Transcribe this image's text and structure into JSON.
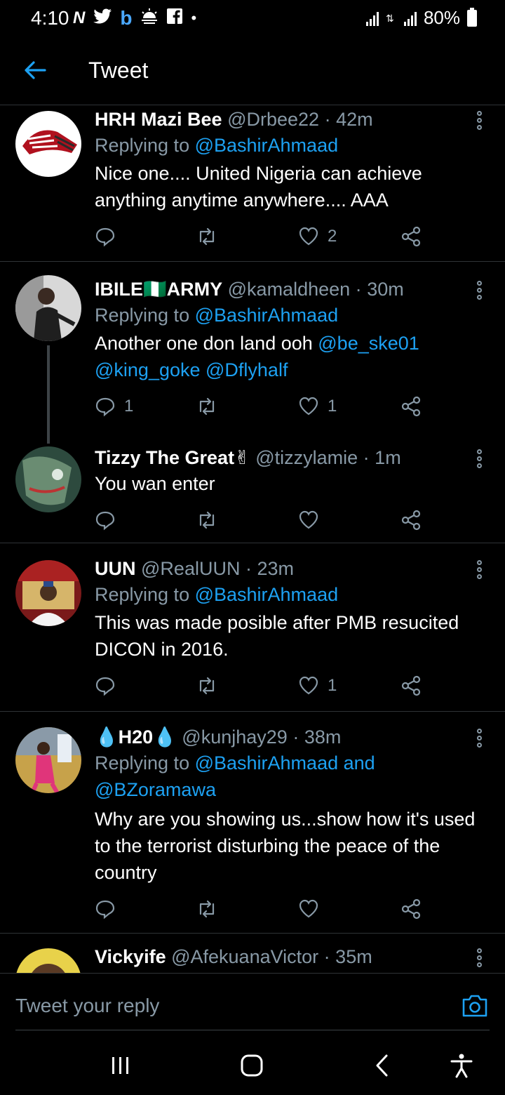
{
  "status_bar": {
    "time": "4:10",
    "battery": "80%",
    "notif_icons": [
      "N",
      "twitter-bird",
      "b",
      "weather",
      "facebook",
      "•"
    ]
  },
  "app_bar": {
    "title": "Tweet"
  },
  "tweets": [
    {
      "name": "HRH Mazi Bee",
      "handle": "@Drbee22",
      "time": "42m",
      "replying_prefix": "Replying to ",
      "replying_to": "@BashirAhmaad",
      "text": "Nice one.... United Nigeria can achieve anything anytime anywhere.... AAA",
      "replies": "",
      "likes": "2"
    },
    {
      "name": "IBILE🇳🇬ARMY",
      "handle": "@kamaldheen",
      "time": "30m",
      "replying_prefix": "Replying to ",
      "replying_to": "@BashirAhmaad",
      "text_prefix": "Another one don land ooh ",
      "mentions": "@be_ske01 @king_goke @Dflyhalf",
      "replies": "1",
      "likes": "1"
    },
    {
      "name": "Tizzy The Great✌",
      "handle": "@tizzylamie",
      "time": "1m",
      "text": "You wan enter",
      "replies": "",
      "likes": ""
    },
    {
      "name": "UUN",
      "handle": "@RealUUN",
      "time": "23m",
      "replying_prefix": "Replying to ",
      "replying_to": "@BashirAhmaad",
      "text": "This was made posible after PMB  resucited DICON in 2016.",
      "replies": "",
      "likes": "1"
    },
    {
      "name": "💧H20💧",
      "handle": "@kunjhay29",
      "time": "38m",
      "replying_prefix": "Replying to ",
      "replying_to": "@BashirAhmaad and @BZoramawa",
      "text": "Why are you showing us...show how it's used to the terrorist disturbing the peace of the country",
      "replies": "",
      "likes": ""
    },
    {
      "name": "Vickyife",
      "handle": "@AfekuanaVictor",
      "time": "35m"
    }
  ],
  "reply_bar": {
    "placeholder": "Tweet your reply"
  },
  "colors": {
    "accent": "#1da1f2",
    "muted": "#8899a6",
    "divider": "#2f3336",
    "background": "#000000"
  },
  "icons": [
    "back-arrow-icon",
    "more-icon",
    "reply-icon",
    "retweet-icon",
    "like-icon",
    "share-icon",
    "camera-icon",
    "recents-icon",
    "home-icon",
    "back-icon",
    "accessibility-icon"
  ]
}
